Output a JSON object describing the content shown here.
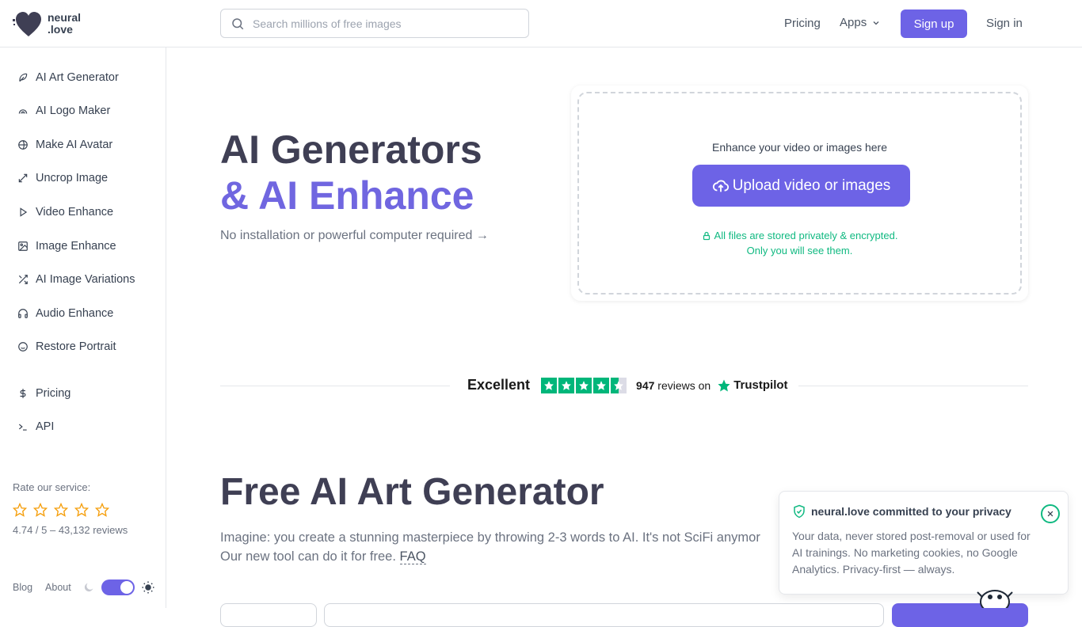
{
  "header": {
    "logo_line1": "neural",
    "logo_line2": ".love",
    "search_placeholder": "Search millions of free images",
    "pricing": "Pricing",
    "apps": "Apps",
    "signup": "Sign up",
    "signin": "Sign in"
  },
  "sidebar": {
    "items": [
      {
        "label": "AI Art Generator",
        "icon": "feather-icon"
      },
      {
        "label": "AI Logo Maker",
        "icon": "logo-icon"
      },
      {
        "label": "Make AI Avatar",
        "icon": "globe-icon"
      },
      {
        "label": "Uncrop Image",
        "icon": "expand-icon"
      },
      {
        "label": "Video Enhance",
        "icon": "play-icon"
      },
      {
        "label": "Image Enhance",
        "icon": "image-icon"
      },
      {
        "label": "AI Image Variations",
        "icon": "shuffle-icon"
      },
      {
        "label": "Audio Enhance",
        "icon": "headphones-icon"
      },
      {
        "label": "Restore Portrait",
        "icon": "smile-icon"
      },
      {
        "label": "Pricing",
        "icon": "dollar-icon"
      },
      {
        "label": "API",
        "icon": "terminal-icon"
      }
    ],
    "rate_label": "Rate our service:",
    "rating": "4.74 / 5 – 43,132 reviews",
    "blog": "Blog",
    "about": "About"
  },
  "hero": {
    "title_line1": "AI Generators",
    "title_line2": "& AI Enhance",
    "subtitle": "No installation or powerful computer required →"
  },
  "upload": {
    "prompt": "Enhance your video or images here",
    "button": "Upload video or images",
    "privacy_line1": "All files are stored privately & encrypted.",
    "privacy_line2": "Only you will see them."
  },
  "trustpilot": {
    "rating_word": "Excellent",
    "count": "947",
    "reviews_on": "reviews on",
    "brand": "Trustpilot"
  },
  "art_section": {
    "title": "Free AI Art Generator",
    "text_line1": "Imagine: you create a stunning masterpiece by throwing 2-3 words to AI. It's not SciFi anymor",
    "text_line2": "Our new tool can do it for free.",
    "faq": "FAQ"
  },
  "toast": {
    "title": "neural.love committed to your privacy",
    "body": "Your data, never stored post-removal or used for AI trainings. No marketing cookies, no Google Analytics. Privacy-first — always."
  },
  "colors": {
    "accent": "#6d63e6",
    "success": "#10b981",
    "trustpilot_green": "#00b67a"
  }
}
